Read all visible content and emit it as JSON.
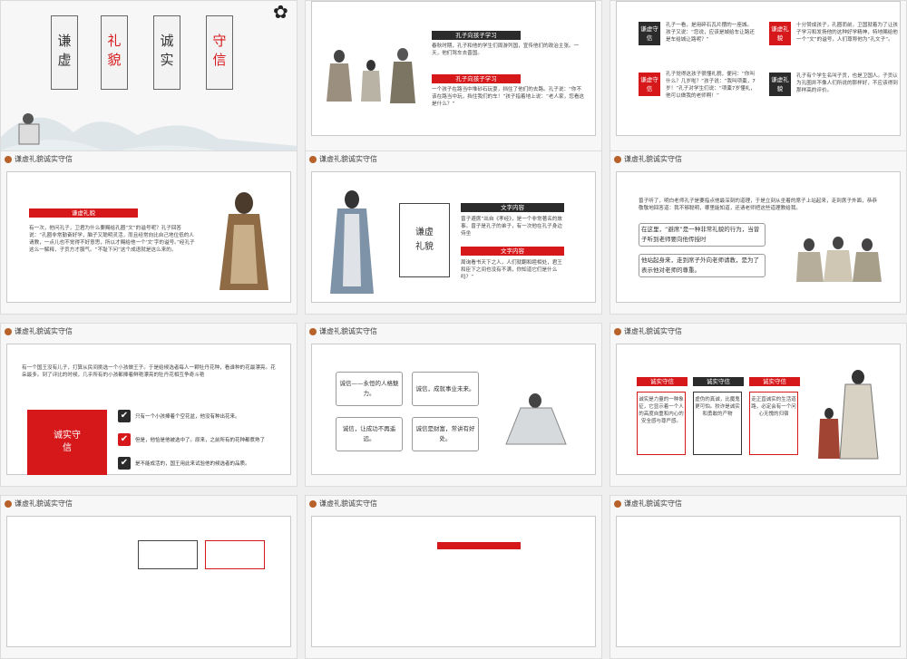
{
  "header_title": "谦虚礼貌诚实守信",
  "s1": {
    "cards": [
      "谦虚",
      "礼貌",
      "诚实",
      "守信"
    ]
  },
  "s2": {
    "h1": "孔子向孩子学习",
    "p1": "春秋时期，孔子和他的学生们周游列国，宣传他们的政治主张。一天，他们驾车去晋国。",
    "h2": "孔子向孩子学习",
    "p2": "一个孩子在路当中堆砂石玩耍，挡住了他们的去路。孔子说：“你不该在路当中玩，挡住我们的车！”孩子指着地上说：“老人家，您看这是什么？”"
  },
  "s3": {
    "tag1": "谦虚守信",
    "text1": "孔子一看，是用碎石瓦片摆的一座城。孩子又说：“您说，应该是城给车让路还是车给城让路呢？”",
    "tag2": "谦虚礼貌",
    "text2": "十分赞成孩子，孔圈而前，卫国就着为了让孩子学习和发扬他的这种好学精神，特地赐给他一个“文”的谥号，人们尊称他为“孔文子”。",
    "tag3": "谦虚守信",
    "text3": "孔子觉得这孩子很懂礼貌，便问：“你叫什么？几岁啦？”孩子说：“我叫项橐，7岁！”孔子对学生们说：“项橐7岁懂礼，他可以做我的老师啊！”",
    "tag4": "谦虚礼貌",
    "text4": "孔子有个学生名叫子贡，也是卫国人。子贡认为孔圈并不像人们所说的那样好，不应该得到那样高的评价。"
  },
  "s4": {
    "tag": "谦虚礼貌",
    "text": "有一次，他问孔子，卫君为什么要赐给孔圈“文”的谥号呢？孔子回答说：“孔圈非常勤奋好学，脑子又聪明灵活，而且经常向比自己地位低的人请教，一点儿也不觉得不好意思，所以才赐给他一个‘文’字的谥号。”经孔子这么一解释，子贡方才服气。“不耻下问”这个成语就是这么来的。"
  },
  "s5": {
    "vert": "谦虚礼貌",
    "h1": "文字内容",
    "p1": "曾子避席”出自《孝经》，是一个非常著名的故事。曾子是孔子的弟子，有一次他在孔子身边侍坐",
    "h2": "文字内容",
    "p2": "周询看书天下之人，人们就翻和睦相处，君王和臣下之间也没有不满，你知道它们是什么吗？”"
  },
  "s6": {
    "intro": "曾子听了，明白老师孔子是要指点他最深刻的道理，于是立刻从坐着的席子上站起来，走到席子外面，恭恭敬敬地回答道：我不够聪明，哪里能知道，还请老师把这些道理教给我。",
    "b1": "在这里，“避席”是一种非常礼貌的行为，当曾子听到老师要向他传授时",
    "b2": "他站起身来，走到席子外向老师请教，是为了表示他对老师的尊重。"
  },
  "s7": {
    "intro": "有一个国王没有儿子，打算从民间挑选一个小孩做王子。于是给候选者每人一颗牡丹花种，看谁种的花最漂亮。花朵最多。到了评比的时候，几乎所有的小孩都捧着鲜艳漂亮的牡丹花相互争奇斗艳",
    "tag": "诚实守信",
    "c1": "只有一个小孩捧着个空花盆，他没有种出花来。",
    "c2": "但是，他恰是他被选中了。原来，之前所有的花种都煮熟了",
    "c3": "是不能成活的，国王用此来试验他的候选者的品质。"
  },
  "s8": {
    "b1": "诚信——永恒的人格魅力。",
    "b2": "诚信，成就事业未来。",
    "b3": "诚信，让成功不再遥远。",
    "b4": "诚信是财富，常讲有好处。"
  },
  "s9": {
    "t1": "诚实守信",
    "t2": "诚实守信",
    "t3": "诚实守信",
    "p1": "诚实是力量的一种象征，它显示着一个人的高度自重和内心的安全感与尊严感。",
    "p2": "虚伪的真诚，比魔鬼更可怕。狡诈是诚实和勇敢的产物",
    "p3": "走正直诚实的生活道路，必定会有一个问心无愧的归宿"
  }
}
